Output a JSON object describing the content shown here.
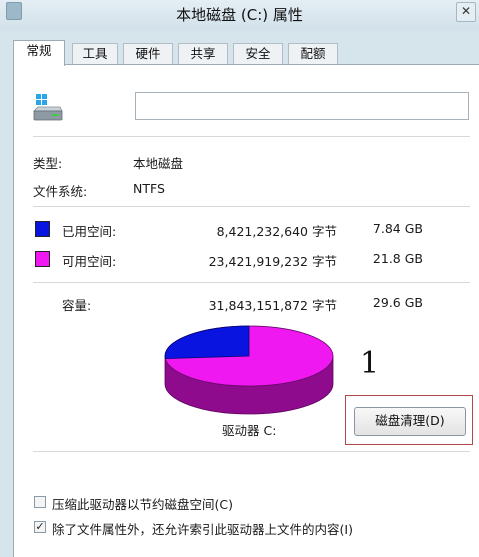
{
  "window": {
    "title": "本地磁盘 (C:) 属性",
    "close_glyph": "✕"
  },
  "tabs": [
    {
      "label": "常规",
      "active": true
    },
    {
      "label": "工具",
      "active": false
    },
    {
      "label": "硬件",
      "active": false
    },
    {
      "label": "共享",
      "active": false
    },
    {
      "label": "安全",
      "active": false
    },
    {
      "label": "配额",
      "active": false
    }
  ],
  "general": {
    "drive_icon": "hard-drive-icon",
    "name_value": "",
    "type_label": "类型:",
    "type_value": "本地磁盘",
    "fs_label": "文件系统:",
    "fs_value": "NTFS"
  },
  "usage": {
    "used": {
      "label": "已用空间:",
      "bytes": "8,421,232,640 字节",
      "size": "7.84 GB",
      "color": "#0a14e0"
    },
    "free": {
      "label": "可用空间:",
      "bytes": "23,421,919,232 字节",
      "size": "21.8 GB",
      "color": "#f018f0"
    },
    "capacity": {
      "label": "容量:",
      "bytes": "31,843,151,872 字节",
      "size": "29.6 GB"
    },
    "used_fraction": 0.264
  },
  "drive_label": "驱动器 C:",
  "annotation_number": "1",
  "cleanup_button": "磁盘清理(D)",
  "options": {
    "compress": {
      "label": "压缩此驱动器以节约磁盘空间(C)",
      "checked": false
    },
    "index": {
      "label": "除了文件属性外，还允许索引此驱动器上文件的内容(I)",
      "checked": true
    }
  }
}
